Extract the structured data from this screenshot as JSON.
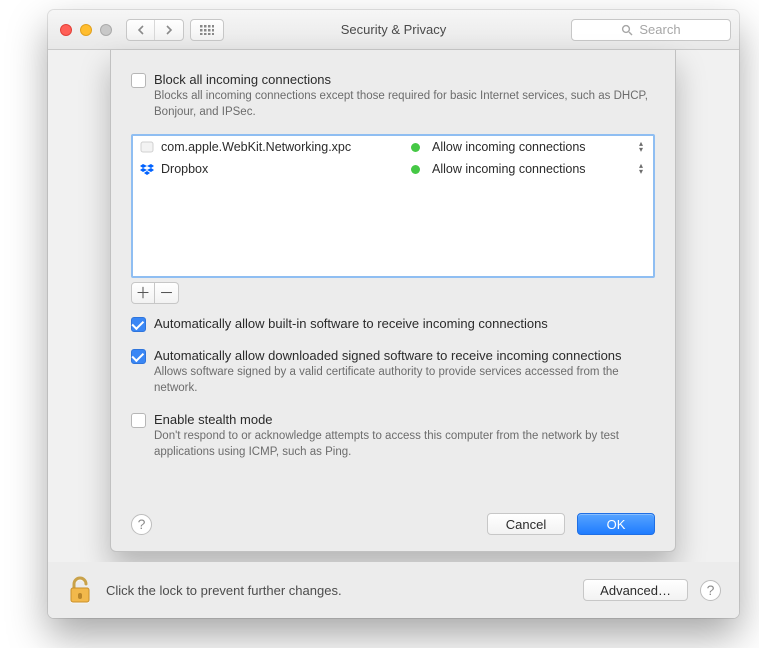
{
  "window": {
    "title": "Security & Privacy",
    "search_placeholder": "Search"
  },
  "sheet": {
    "block_all": {
      "label": "Block all incoming connections",
      "desc": "Blocks all incoming connections except those required for basic Internet services, such as DHCP, Bonjour, and IPSec.",
      "checked": false
    },
    "apps": [
      {
        "name": "com.apple.WebKit.Networking.xpc",
        "status": "Allow incoming connections",
        "icon": "generic"
      },
      {
        "name": "Dropbox",
        "status": "Allow incoming connections",
        "icon": "dropbox"
      }
    ],
    "auto_builtin": {
      "label": "Automatically allow built-in software to receive incoming connections",
      "checked": true
    },
    "auto_signed": {
      "label": "Automatically allow downloaded signed software to receive incoming connections",
      "desc": "Allows software signed by a valid certificate authority to provide services accessed from the network.",
      "checked": true
    },
    "stealth": {
      "label": "Enable stealth mode",
      "desc": "Don't respond to or acknowledge attempts to access this computer from the network by test applications using ICMP, such as Ping.",
      "checked": false
    },
    "cancel": "Cancel",
    "ok": "OK"
  },
  "bottom": {
    "msg": "Click the lock to prevent further changes.",
    "advanced": "Advanced…"
  }
}
